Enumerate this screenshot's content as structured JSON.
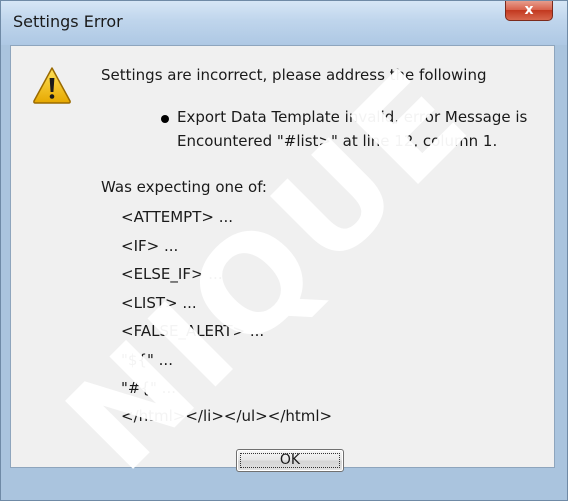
{
  "window": {
    "title": "Settings Error",
    "close_label": "x"
  },
  "dialog": {
    "message": "Settings are incorrect, please address the following",
    "error_lines": [
      "Export Data Template invalid, error Message is",
      "Encountered \"#list>\" at line 12, column 1."
    ],
    "expecting_label": "Was expecting one of:",
    "expected_tokens": [
      "<ATTEMPT> ...",
      "<IF> ...",
      "<ELSE_IF> ...",
      "<LIST> ...",
      "<FALSE_ALERT> ...",
      "\"${\" ...",
      "\"#{\" ...",
      "</html></li></ul></html>"
    ],
    "ok_label": "OK",
    "icon": "warning-icon"
  },
  "watermark": {
    "text": "NIQUE",
    "color": "#ffffff"
  },
  "colors": {
    "frame": "#aac4de",
    "content_bg": "#f0f0f0",
    "close_button": "#c2381f",
    "warning_yellow": "#f5c400"
  }
}
